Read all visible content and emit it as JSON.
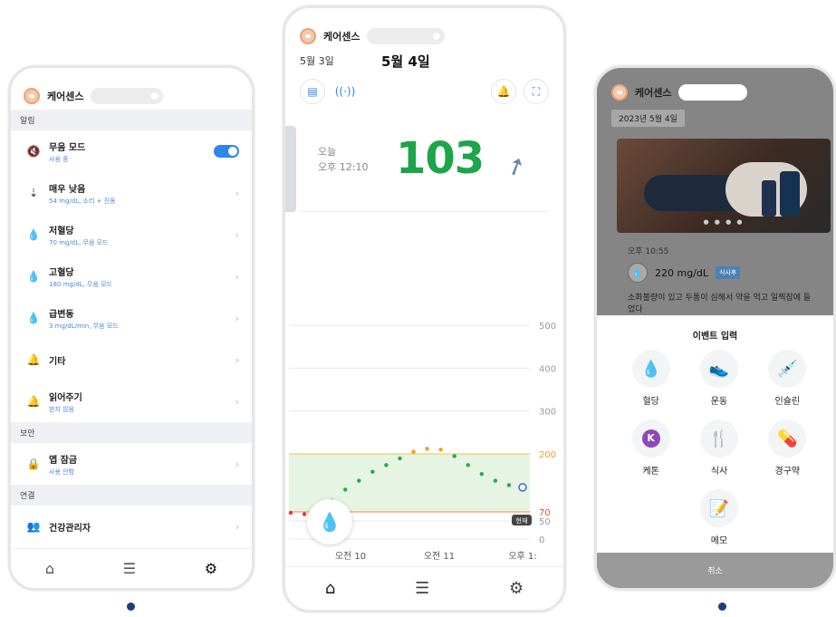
{
  "brand": "케어센스",
  "phone1": {
    "sections": [
      {
        "title": "알림",
        "items": [
          {
            "icon": "mute-speaker-icon",
            "title": "무음 모드",
            "subtitle": "사용 중",
            "control": "toggle"
          },
          {
            "icon": "arrows-down-icon",
            "title": "매우 낮음",
            "subtitle": "54 mg/dL, 소리 + 진동",
            "control": "chevron"
          },
          {
            "icon": "drop-low-icon",
            "title": "저혈당",
            "subtitle": "70 mg/dL, 무음 모드",
            "control": "chevron"
          },
          {
            "icon": "drop-high-icon",
            "title": "고혈당",
            "subtitle": "180 mg/dL, 무음 모드",
            "control": "chevron"
          },
          {
            "icon": "drop-change-icon",
            "title": "급변동",
            "subtitle": "3 mg/dL/min, 무음 모드",
            "control": "chevron"
          },
          {
            "icon": "bell-wave-icon",
            "title": "기타",
            "subtitle": "",
            "control": "chevron"
          },
          {
            "icon": "bell-icon",
            "title": "읽어주기",
            "subtitle": "받지 않음",
            "control": "chevron"
          }
        ]
      },
      {
        "title": "보안",
        "items": [
          {
            "icon": "lock-icon",
            "title": "앱 잠금",
            "subtitle": "사용 안함",
            "control": "chevron"
          }
        ]
      },
      {
        "title": "연결",
        "items": [
          {
            "icon": "people-icon",
            "title": "건강관리자",
            "subtitle": "",
            "control": "chevron"
          }
        ]
      }
    ],
    "tabs": [
      "home-icon",
      "list-icon",
      "gear-icon"
    ]
  },
  "phone2": {
    "date_prev": "5월 3일",
    "date_current": "5월 4일",
    "reading_label_line1": "오늘",
    "reading_label_line2": "오후 12:10",
    "reading_value": "103",
    "now_badge": "현재",
    "tabs": [
      "home-icon",
      "list-icon",
      "gear-icon"
    ]
  },
  "phone3": {
    "date": "2023년 5월 4일",
    "time": "오후 10:55",
    "glucose": "220 mg/dL",
    "meal_tag": "식사후",
    "note": "소화불량이 있고 두통이 심해서 약을 먹고 일찍잠에 들었다",
    "sheet_title": "이벤트 입력",
    "events": [
      {
        "label": "혈당",
        "icon": "blood-drop-icon"
      },
      {
        "label": "운동",
        "icon": "shoe-icon"
      },
      {
        "label": "인슐린",
        "icon": "syringe-icon"
      },
      {
        "label": "케톤",
        "icon": "ketone-icon"
      },
      {
        "label": "식사",
        "icon": "fork-knife-icon"
      },
      {
        "label": "경구약",
        "icon": "pill-icon"
      },
      {
        "label": "메모",
        "icon": "memo-icon"
      }
    ],
    "cancel": "취소"
  },
  "chart_data": {
    "type": "line",
    "y_ticks": [
      500,
      400,
      300,
      200,
      70,
      50,
      0
    ],
    "x_ticks": [
      "오전 10",
      "오전 11",
      "오후 1:"
    ],
    "target_range": [
      70,
      200
    ],
    "series": [
      {
        "values": [
          68,
          65,
          70,
          95,
          120,
          140,
          160,
          175,
          190,
          205,
          212,
          210,
          195,
          175,
          155,
          140,
          130,
          125
        ]
      }
    ],
    "ylim": [
      0,
      500
    ],
    "grid": true
  }
}
